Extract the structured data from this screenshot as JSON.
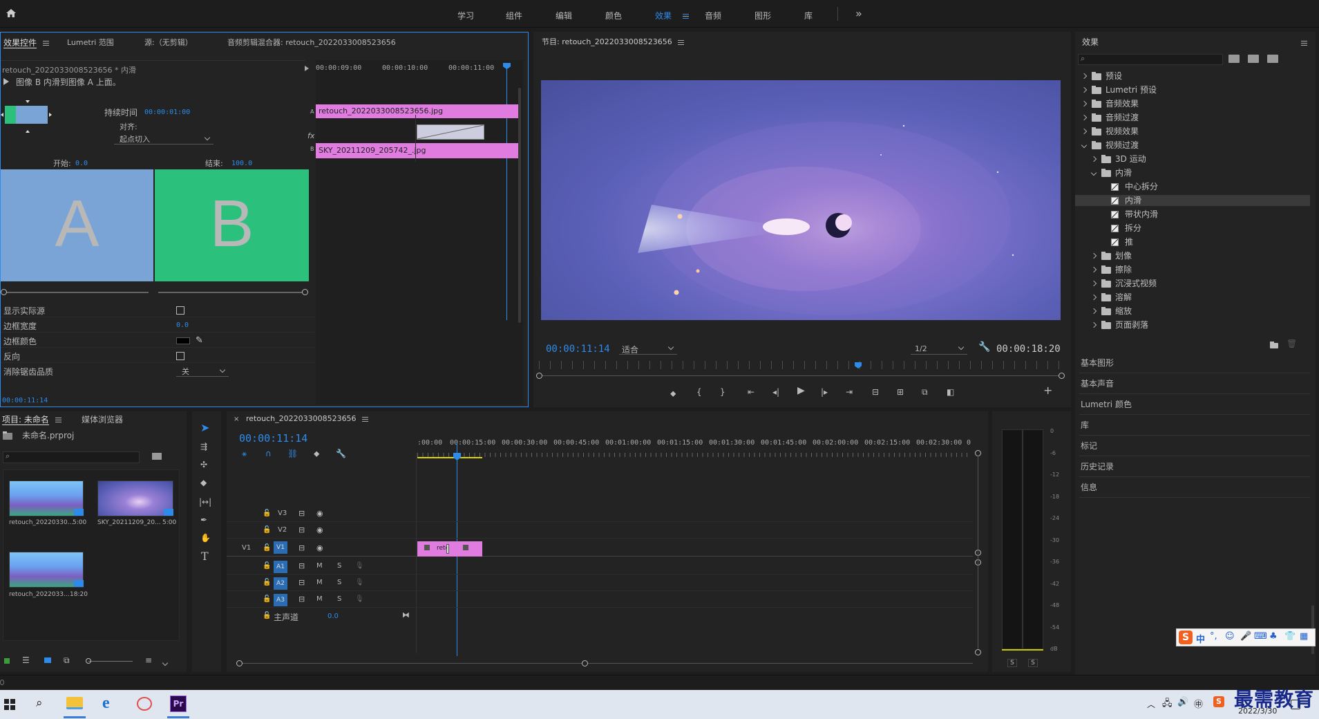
{
  "workspace_tabs": {
    "learn": "学习",
    "assembly": "组件",
    "editing": "编辑",
    "color": "颜色",
    "effects": "效果",
    "audio": "音频",
    "graphics": "图形",
    "libraries": "库",
    "more": "»"
  },
  "effect_controls": {
    "tabs": [
      "效果控件",
      "Lumetri 范围",
      "源:（无剪辑）",
      "音频剪辑混合器: retouch_2022033008523656"
    ],
    "clip_name": "retouch_2022033008523656 * 内滑",
    "description": "图像 B 内滑到图像 A 上面。",
    "duration_label": "持续时间",
    "duration_value": "00:00:01:00",
    "align_label": "对齐:",
    "align_value": "起点切入",
    "start_label": "开始:",
    "start_value": "0.0",
    "end_label": "结束:",
    "end_value": "100.0",
    "preview_a": "A",
    "preview_b": "B",
    "props": [
      {
        "label": "显示实际源",
        "value": ""
      },
      {
        "label": "边框宽度",
        "value": "0.0"
      },
      {
        "label": "边框颜色",
        "value": ""
      },
      {
        "label": "反向",
        "value": ""
      },
      {
        "label": "消除锯齿品质",
        "value": "关"
      }
    ],
    "timecode": "00:00:11:14",
    "mini_ruler": [
      "00:00:09:00",
      "00:00:10:00",
      "00:00:11:00"
    ],
    "clip_a": "retouch_2022033008523656.jpg",
    "clip_b": "SKY_20211209_205742_.jpg",
    "track_a": "A",
    "track_b": "B",
    "fx": "fx"
  },
  "program": {
    "title": "节目: retouch_2022033008523656",
    "timecode": "00:00:11:14",
    "fit": "适合",
    "resolution": "1/2",
    "duration": "00:00:18:20"
  },
  "effects_panel": {
    "title": "效果",
    "search_placeholder": "",
    "tree": [
      {
        "label": "预设",
        "level": 0,
        "type": "folder",
        "open": false
      },
      {
        "label": "Lumetri 预设",
        "level": 0,
        "type": "folder",
        "open": false
      },
      {
        "label": "音频效果",
        "level": 0,
        "type": "folder",
        "open": false
      },
      {
        "label": "音频过渡",
        "level": 0,
        "type": "folder",
        "open": false
      },
      {
        "label": "视频效果",
        "level": 0,
        "type": "folder",
        "open": false
      },
      {
        "label": "视频过渡",
        "level": 0,
        "type": "folder",
        "open": true
      },
      {
        "label": "3D 运动",
        "level": 1,
        "type": "folder",
        "open": false
      },
      {
        "label": "内滑",
        "level": 1,
        "type": "folder",
        "open": true
      },
      {
        "label": "中心拆分",
        "level": 2,
        "type": "fx"
      },
      {
        "label": "内滑",
        "level": 2,
        "type": "fx",
        "selected": true
      },
      {
        "label": "带状内滑",
        "level": 2,
        "type": "fx"
      },
      {
        "label": "拆分",
        "level": 2,
        "type": "fx"
      },
      {
        "label": "推",
        "level": 2,
        "type": "fx"
      },
      {
        "label": "划像",
        "level": 1,
        "type": "folder",
        "open": false
      },
      {
        "label": "擦除",
        "level": 1,
        "type": "folder",
        "open": false
      },
      {
        "label": "沉浸式视频",
        "level": 1,
        "type": "folder",
        "open": false
      },
      {
        "label": "溶解",
        "level": 1,
        "type": "folder",
        "open": false
      },
      {
        "label": "缩放",
        "level": 1,
        "type": "folder",
        "open": false
      },
      {
        "label": "页面剥落",
        "level": 1,
        "type": "folder",
        "open": false
      }
    ],
    "sections": [
      "基本图形",
      "基本声音",
      "Lumetri 颜色",
      "库",
      "标记",
      "历史记录",
      "信息"
    ]
  },
  "project": {
    "tabs": [
      "项目: 未命名",
      "媒体浏览器"
    ],
    "file": "未命名.prproj",
    "items": [
      {
        "name": "retouch_20220330...",
        "duration": "5:00"
      },
      {
        "name": "SKY_20211209_20...",
        "duration": "5:00"
      },
      {
        "name": "retouch_2022033...",
        "duration": "18:20"
      }
    ]
  },
  "timeline": {
    "tab": "retouch_2022033008523656",
    "timecode": "00:00:11:14",
    "ruler": [
      ":00:00",
      "00:00:15:00",
      "00:00:30:00",
      "00:00:45:00",
      "00:01:00:00",
      "00:01:15:00",
      "00:01:30:00",
      "00:01:45:00",
      "00:02:00:00",
      "00:02:15:00",
      "00:02:30:00",
      "0"
    ],
    "video_tracks": [
      "V3",
      "V2",
      "V1"
    ],
    "audio_tracks": [
      "A1",
      "A2",
      "A3"
    ],
    "source_patch": "V1",
    "master_label": "主声道",
    "master_value": "0.0",
    "clip_label": "reto",
    "mute": "M",
    "solo": "S"
  },
  "meter": {
    "ticks": [
      "0",
      "-6",
      "-12",
      "-18",
      "-24",
      "-30",
      "-36",
      "-42",
      "-48",
      "-54",
      "dB"
    ],
    "solo": [
      "S",
      "S"
    ]
  },
  "taskbar": {
    "date": "2022/3/30",
    "ime_label": "中"
  },
  "watermark": "最需教育",
  "colors": {
    "accent_blue": "#2d8ceb",
    "clip_pink": "#e07ce0",
    "preview_a_bg": "#7aa3d6",
    "preview_b_bg": "#2bc07c",
    "playhead": "#2d8ceb"
  }
}
